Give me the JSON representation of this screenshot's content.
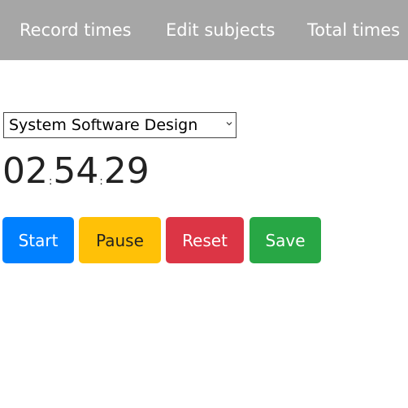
{
  "nav": {
    "items": [
      {
        "label": "Record times"
      },
      {
        "label": "Edit subjects"
      },
      {
        "label": "Total times"
      }
    ]
  },
  "subject_select": {
    "selected": "System Software Design"
  },
  "timer": {
    "hours": "02",
    "minutes": "54",
    "seconds": "29",
    "separator": ":"
  },
  "controls": {
    "start_label": "Start",
    "pause_label": "Pause",
    "reset_label": "Reset",
    "save_label": "Save"
  },
  "colors": {
    "navbar_bg": "#a6a6a6",
    "start": "#0080ff",
    "pause": "#ffc107",
    "reset": "#dc3545",
    "save": "#28a745"
  }
}
